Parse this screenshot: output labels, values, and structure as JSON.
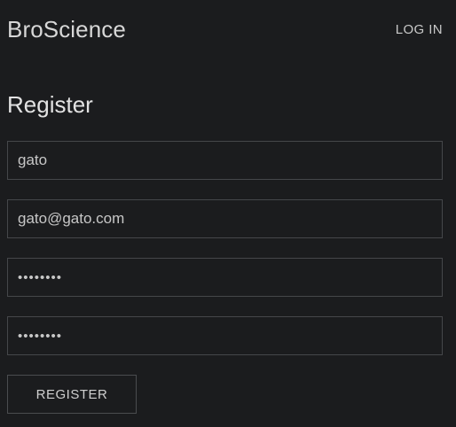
{
  "header": {
    "brand": "BroScience",
    "login_label": "LOG IN"
  },
  "main": {
    "title": "Register",
    "fields": {
      "username": {
        "value": "gato"
      },
      "email": {
        "value": "gato@gato.com"
      },
      "password": {
        "value": "••••••••"
      },
      "password_confirm": {
        "value": "••••••••"
      }
    },
    "submit_label": "REGISTER"
  },
  "colors": {
    "background": "#1b1c1e",
    "border": "#45474a",
    "text": "#d2d2d2"
  }
}
